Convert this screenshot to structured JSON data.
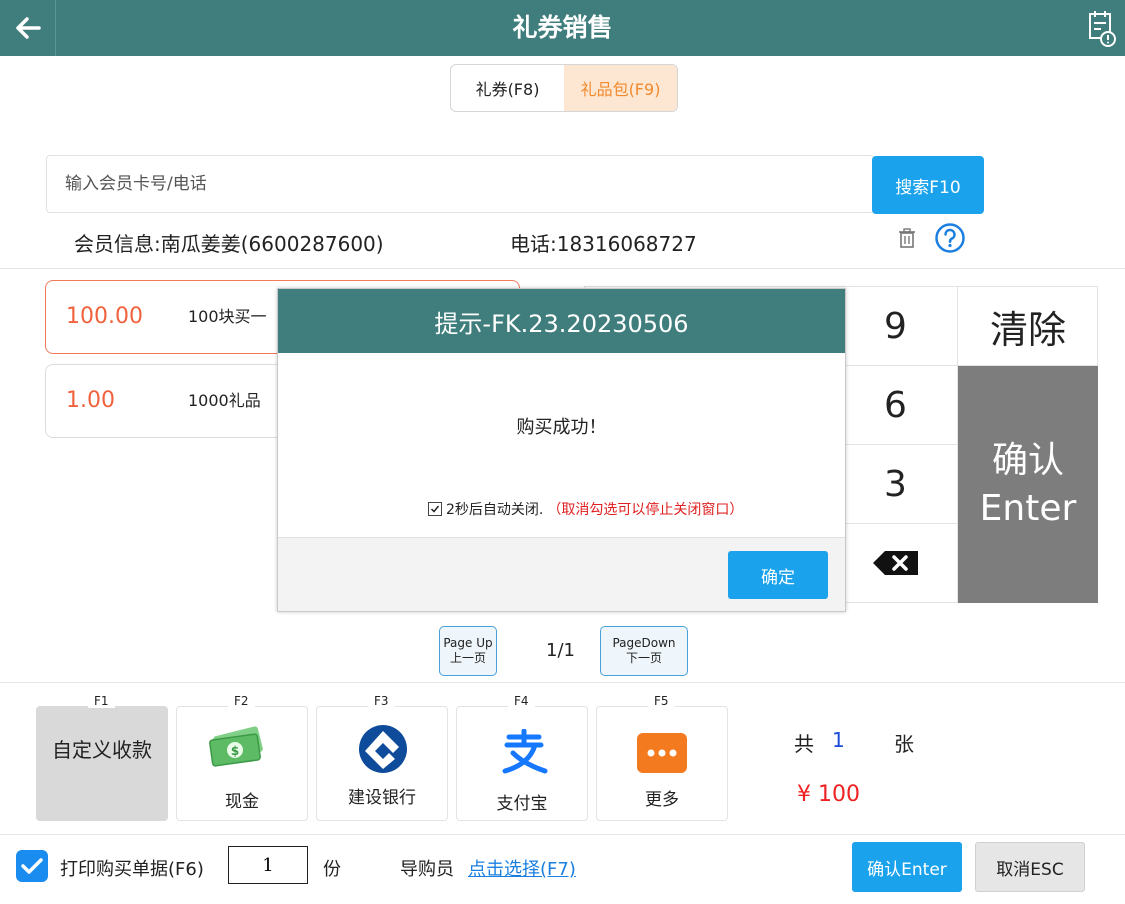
{
  "header": {
    "title": "礼券销售",
    "back_icon": "arrow-left-icon",
    "corner_icon": "calendar-clock-icon"
  },
  "tabs": [
    {
      "label": "礼券(F8)",
      "active": false
    },
    {
      "label": "礼品包(F9)",
      "active": true
    }
  ],
  "search": {
    "placeholder": "输入会员卡号/电话",
    "value": "",
    "button_label": "搜索F10"
  },
  "member": {
    "info": "会员信息:南瓜姜姜(6600287600)",
    "phone": "电话:18316068727"
  },
  "items": [
    {
      "price": "100.00",
      "name": "100块买一",
      "selected": true
    },
    {
      "price": "1.00",
      "name": "1000礼品",
      "selected": false
    }
  ],
  "keypad": {
    "keys": [
      "9",
      "6",
      "3"
    ],
    "clear": "清除",
    "enter_line1": "确认",
    "enter_line2": "Enter",
    "backspace_icon": "backspace-icon"
  },
  "paging": {
    "up_line1": "Page Up",
    "up_line2": "上一页",
    "indicator": "1/1",
    "down_line1": "PageDown",
    "down_line2": "下一页"
  },
  "payments": [
    {
      "key": "F1",
      "label": "自定义收款",
      "icon": ""
    },
    {
      "key": "F2",
      "label": "现金",
      "icon": "cash-icon"
    },
    {
      "key": "F3",
      "label": "建设银行",
      "icon": "ccb-bank-icon"
    },
    {
      "key": "F4",
      "label": "支付宝",
      "icon": "alipay-icon"
    },
    {
      "key": "F5",
      "label": "更多",
      "icon": "more-icon"
    }
  ],
  "totals": {
    "count_label": "共",
    "count": "1",
    "unit": "张",
    "amount": "¥  100"
  },
  "footer": {
    "print_label": "打印购买单据(F6)",
    "copies": "1",
    "copies_unit": "份",
    "guide_label": "导购员",
    "guide_select": "点击选择(F7)",
    "confirm": "确认Enter",
    "cancel": "取消ESC"
  },
  "modal": {
    "title": "提示-FK.23.20230506",
    "message": "购买成功！",
    "autoclose": "2秒后自动关闭.",
    "hint": "（取消勾选可以停止关闭窗口）",
    "ok": "确定"
  },
  "colors": {
    "header": "#3f7e7c",
    "accent": "#1aa3ec",
    "price": "#f0623e",
    "gift_tab": "#f08a2e"
  }
}
